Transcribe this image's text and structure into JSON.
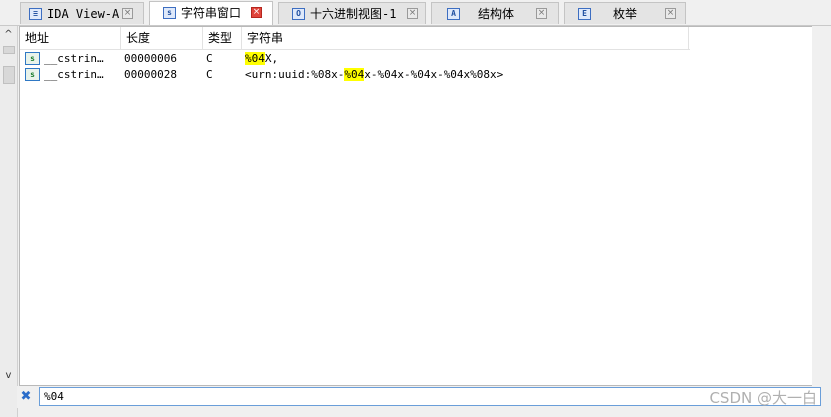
{
  "left_gutter": {
    "up_arrow": "^",
    "down_arrow": "v",
    "tab_scroll_arrow": "<"
  },
  "tabs": [
    {
      "label": "IDA View-A",
      "icon": "listing-icon",
      "icon_glyph": "≡",
      "active": false,
      "close": "×"
    },
    {
      "label": "字符串窗口",
      "icon": "strings-icon",
      "icon_glyph": "s",
      "active": true,
      "close": "×"
    },
    {
      "label": "十六进制视图-1",
      "icon": "hex-view-icon",
      "icon_glyph": "O",
      "active": false,
      "close": "×"
    },
    {
      "label": "结构体",
      "icon": "structures-icon",
      "icon_glyph": "A",
      "active": false,
      "close": "×"
    },
    {
      "label": "枚举",
      "icon": "enums-icon",
      "icon_glyph": "E",
      "active": false,
      "close": "×"
    }
  ],
  "table": {
    "columns": [
      "地址",
      "长度",
      "类型",
      "字符串"
    ],
    "rows": [
      {
        "icon_glyph": "s",
        "address": "__cstrin…",
        "length": "00000006",
        "type": "C",
        "str_pre": "",
        "str_match": "%04",
        "str_post": "X,"
      },
      {
        "icon_glyph": "s",
        "address": "__cstrin…",
        "length": "00000028",
        "type": "C",
        "str_pre": "<urn:uuid:%08x-",
        "str_match": "%04",
        "str_post": "x-%04x-%04x-%04x%08x>"
      }
    ]
  },
  "search": {
    "value": "%04",
    "close_glyph": "✖"
  },
  "watermark": "CSDN @大一白",
  "colors": {
    "highlight": "#ffff00",
    "active_close": "#e0443b",
    "accent": "#2a6cc9"
  }
}
